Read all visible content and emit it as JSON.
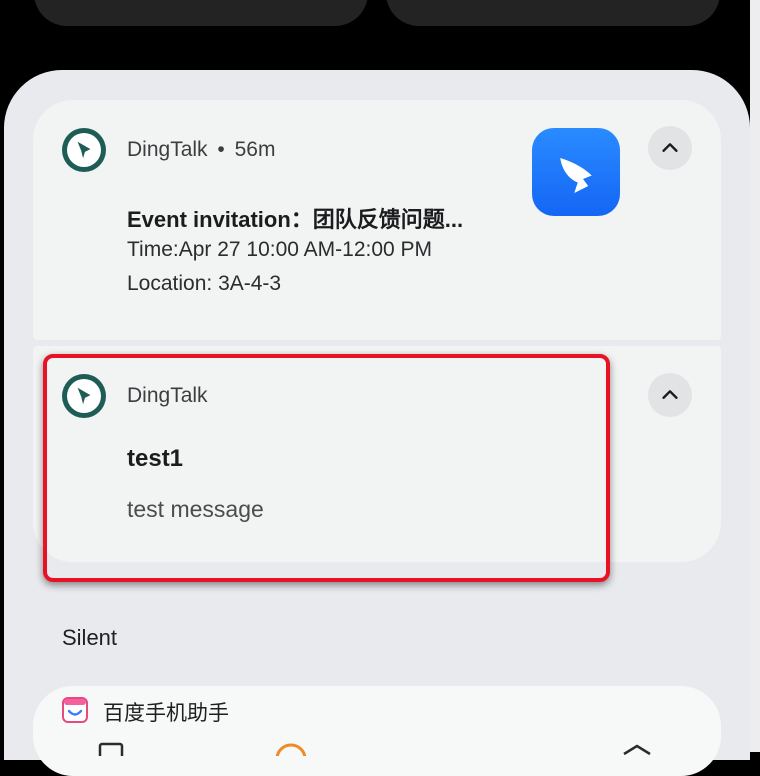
{
  "notifications": [
    {
      "app_name": "DingTalk",
      "separator": "•",
      "time": "56m",
      "title": "Event invitation：团队反馈问题...",
      "lines": [
        "Time:Apr 27 10:00 AM-12:00 PM",
        "Location: 3A-4-3"
      ]
    },
    {
      "app_name": "DingTalk",
      "title": "test1",
      "lines": [
        "test message"
      ]
    }
  ],
  "silent_section": {
    "label": "Silent",
    "app_name": "百度手机助手"
  },
  "icons": {
    "app": "dingtalk-icon",
    "expand": "chevron-up-icon",
    "large": "dingtalk-wing-icon",
    "silent_app": "baidu-assistant-icon"
  },
  "colors": {
    "highlight": "#e81224",
    "dingtalk_teal": "#1d5d55",
    "dingtalk_blue": "#1466f5"
  }
}
